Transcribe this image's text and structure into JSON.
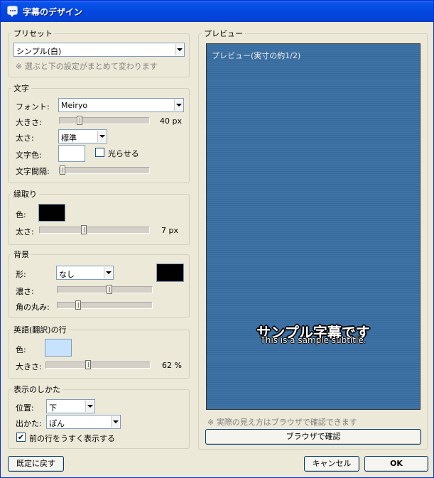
{
  "window": {
    "title": "字幕のデザイン"
  },
  "preset": {
    "legend": "プリセット",
    "selected": "シンプル(白)",
    "note": "※ 選ぶと下の設定がまとめて変わります"
  },
  "text": {
    "legend": "文字",
    "font_label": "フォント:",
    "font_value": "Meiryo",
    "size_label": "大きさ:",
    "size_value": "40 px",
    "size_level": 0.2,
    "weight_label": "太さ:",
    "weight_value": "標準",
    "color_label": "文字色:",
    "color": "#ffffff",
    "glow_label": "光らせる",
    "glow_checked": false,
    "spacing_label": "文字間隔:",
    "spacing_level": 0.0
  },
  "outline": {
    "legend": "縁取り",
    "color_label": "色:",
    "color": "#000000",
    "width_label": "太さ:",
    "width_value": "7 px",
    "width_level": 0.4
  },
  "background": {
    "legend": "背景",
    "shape_label": "形:",
    "shape_value": "なし",
    "color": "#000000",
    "opacity_label": "濃さ:",
    "opacity_level": 0.55,
    "radius_label": "角の丸み:",
    "radius_level": 0.2
  },
  "english": {
    "legend": "英語(翻訳)の行",
    "color_label": "色:",
    "color": "#c6e2ff",
    "size_label": "大きさ:",
    "size_value": "62 %",
    "size_level": 0.4
  },
  "display": {
    "legend": "表示のしかた",
    "position_label": "位置:",
    "position_value": "下",
    "appear_label": "出かた:",
    "appear_value": "ぽん",
    "fade_label": "前の行をうすく表示する",
    "fade_checked": true
  },
  "preview": {
    "legend": "プレビュー",
    "caption": "プレビュー(実寸の約1/2)",
    "subtitle_ja": "サンプル字幕です",
    "subtitle_en": "This is a sample subtitle.",
    "note": "※ 実際の見え方はブラウザで確認できます",
    "browser_button": "ブラウザで確認"
  },
  "footer": {
    "reset_button": "既定に戻す",
    "cancel_button": "キャンセル",
    "ok_button": "OK"
  }
}
